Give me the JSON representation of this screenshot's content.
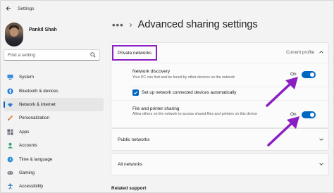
{
  "window": {
    "title": "Settings"
  },
  "profile": {
    "name": "Pankil Shah"
  },
  "search": {
    "placeholder": "Find a setting"
  },
  "sidebar": {
    "items": [
      {
        "label": "System",
        "icon": "monitor-icon",
        "active": false
      },
      {
        "label": "Bluetooth & devices",
        "icon": "bluetooth-icon",
        "active": false
      },
      {
        "label": "Network & internet",
        "icon": "wifi-icon",
        "active": true
      },
      {
        "label": "Personalization",
        "icon": "brush-icon",
        "active": false
      },
      {
        "label": "Apps",
        "icon": "apps-icon",
        "active": false
      },
      {
        "label": "Accounts",
        "icon": "person-icon",
        "active": false
      },
      {
        "label": "Time & language",
        "icon": "globe-clock-icon",
        "active": false
      },
      {
        "label": "Gaming",
        "icon": "gamepad-icon",
        "active": false
      },
      {
        "label": "Accessibility",
        "icon": "accessibility-icon",
        "active": false
      }
    ]
  },
  "header": {
    "more": "•••",
    "separator": "›",
    "title": "Advanced sharing settings"
  },
  "private_networks": {
    "label": "Private networks",
    "status": "Current profile",
    "network_discovery": {
      "title": "Network discovery",
      "description": "Your PC can find and be found by other devices on the network",
      "state": "On"
    },
    "auto_setup": {
      "label": "Set up network connected devices automatically",
      "checked": true
    },
    "file_printer_sharing": {
      "title": "File and printer sharing",
      "description": "Allow others on the network to access shared files and printers on this device",
      "state": "On"
    }
  },
  "public_networks": {
    "label": "Public networks"
  },
  "all_networks": {
    "label": "All networks"
  },
  "related": {
    "label": "Related support"
  },
  "colors": {
    "accent": "#0067c0",
    "highlight": "#8b1ec2",
    "arrow": "#8b1ec2"
  }
}
